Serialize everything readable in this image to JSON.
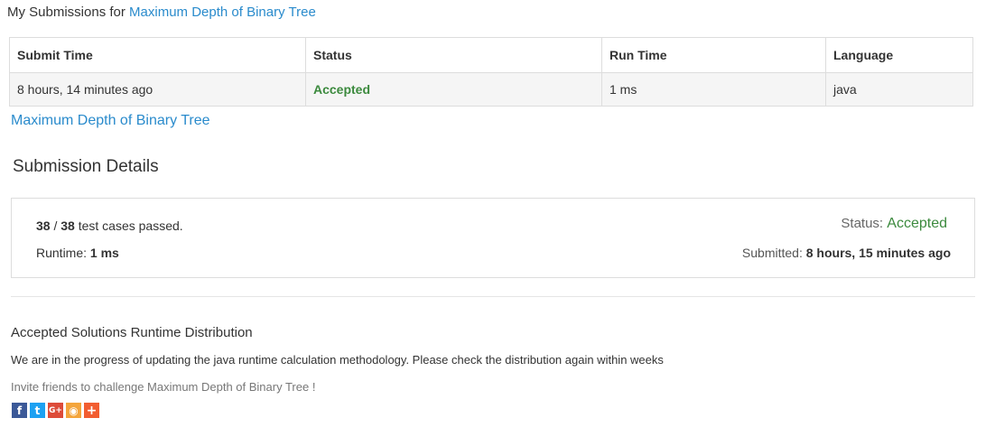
{
  "header": {
    "prefix": "My Submissions for",
    "problem_link": "Maximum Depth of Binary Tree"
  },
  "table": {
    "columns": [
      "Submit Time",
      "Status",
      "Run Time",
      "Language"
    ],
    "rows": [
      {
        "submit_time": "8 hours, 14 minutes ago",
        "status": "Accepted",
        "run_time": "1 ms",
        "language": "java"
      }
    ]
  },
  "problem_link": "Maximum Depth of Binary Tree",
  "details": {
    "title": "Submission Details",
    "passed": "38",
    "total": "38",
    "cases_suffix": "test cases passed.",
    "runtime_label": "Runtime:",
    "runtime_value": "1 ms",
    "status_label": "Status:",
    "status_value": "Accepted",
    "submitted_label": "Submitted:",
    "submitted_value": "8 hours, 15 minutes ago"
  },
  "distribution": {
    "title": "Accepted Solutions Runtime Distribution",
    "note": "We are in the progress of updating the java runtime calculation methodology. Please check the distribution again within weeks"
  },
  "invite": "Invite friends to challenge Maximum Depth of Binary Tree !",
  "share_icons": [
    {
      "name": "facebook-icon",
      "glyph": "f"
    },
    {
      "name": "twitter-icon",
      "glyph": "t"
    },
    {
      "name": "google-plus-icon",
      "glyph": "G+"
    },
    {
      "name": "weibo-icon",
      "glyph": "◉"
    },
    {
      "name": "more-share-icon",
      "glyph": "+"
    }
  ],
  "colors": {
    "link": "#2a8bcc",
    "accepted": "#3c8a3e"
  }
}
